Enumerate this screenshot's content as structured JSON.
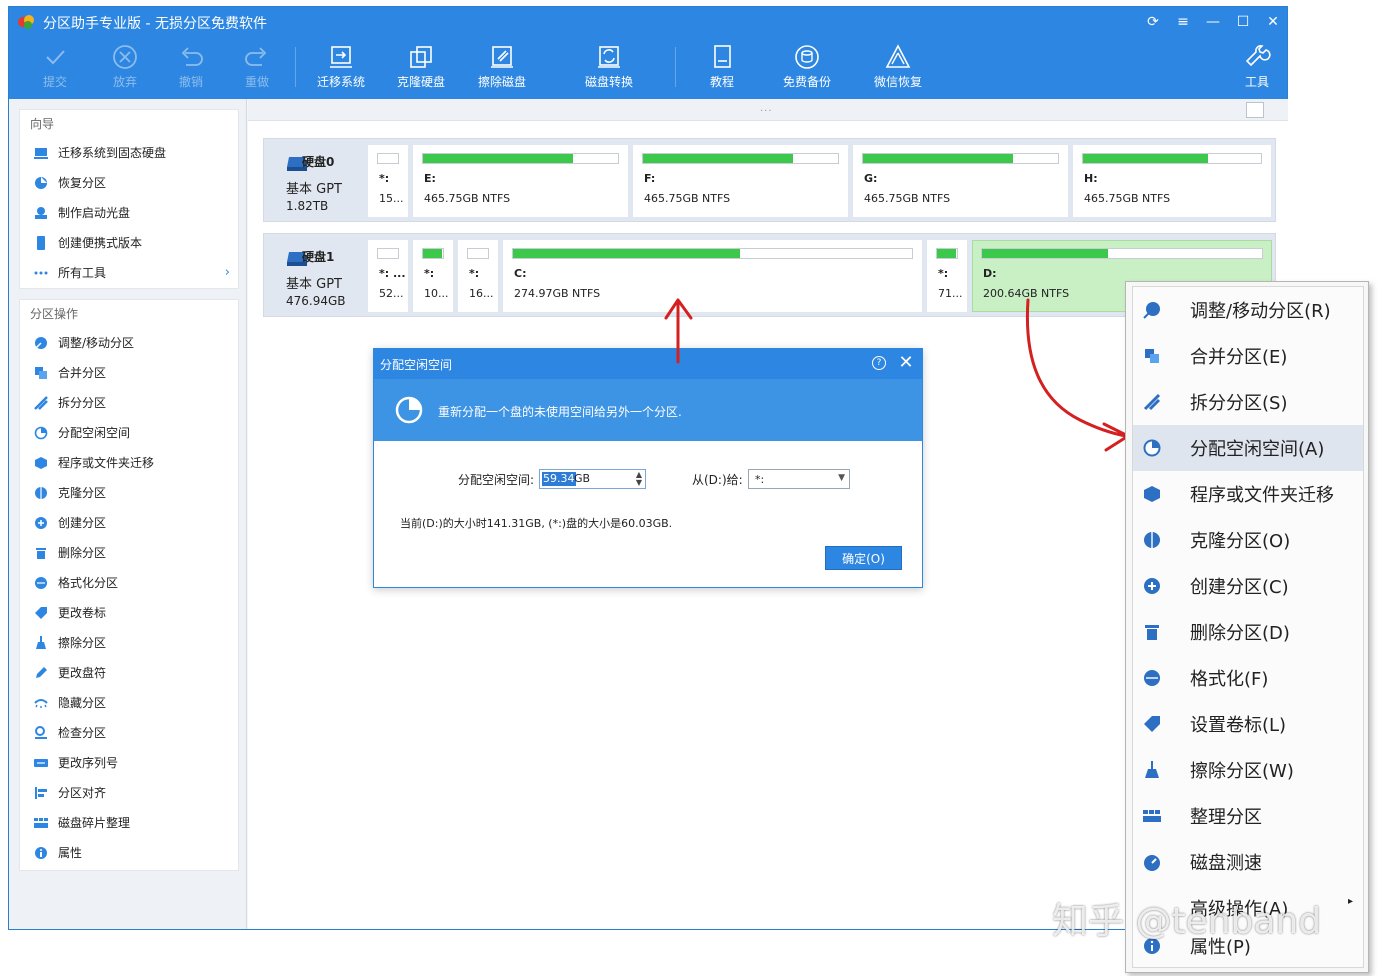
{
  "window": {
    "title": "分区助手专业版 - 无损分区免费软件",
    "controls": {
      "refresh": "⟳",
      "menu": "≡",
      "min": "—",
      "max": "☐",
      "close": "✕"
    }
  },
  "toolbar": {
    "commit": "提交",
    "discard": "放弃",
    "undo": "撤销",
    "redo": "重做",
    "migrate_os": "迁移系统",
    "clone_disk": "克隆硬盘",
    "wipe_disk": "擦除磁盘",
    "disk_convert": "磁盘转换",
    "tutorial": "教程",
    "free_backup": "免费备份",
    "wechat_recover": "微信恢复",
    "tools": "工具"
  },
  "sidebar": {
    "wizard_header": "向导",
    "wizard": [
      "迁移系统到固态硬盘",
      "恢复分区",
      "制作启动光盘",
      "创建便携式版本",
      "所有工具"
    ],
    "ops_header": "分区操作",
    "ops": [
      "调整/移动分区",
      "合并分区",
      "拆分分区",
      "分配空闲空间",
      "程序或文件夹迁移",
      "克隆分区",
      "创建分区",
      "删除分区",
      "格式化分区",
      "更改卷标",
      "擦除分区",
      "更改盘符",
      "隐藏分区",
      "检查分区",
      "更改序列号",
      "分区对齐",
      "磁盘碎片整理",
      "属性"
    ]
  },
  "main": {
    "drag_handle": "···"
  },
  "disks": [
    {
      "name": "硬盘0",
      "type": "基本 GPT",
      "size": "1.82TB",
      "partitions": [
        {
          "label": "*:",
          "info": "15...",
          "fill": 0
        },
        {
          "label": "E:",
          "info": "465.75GB NTFS",
          "fill": 0.77
        },
        {
          "label": "F:",
          "info": "465.75GB NTFS",
          "fill": 0.77
        },
        {
          "label": "G:",
          "info": "465.75GB NTFS",
          "fill": 0.77
        },
        {
          "label": "H:",
          "info": "465.75GB NTFS",
          "fill": 0.7
        }
      ]
    },
    {
      "name": "硬盘1",
      "type": "基本 GPT",
      "size": "476.94GB",
      "partitions": [
        {
          "label": "*: ...",
          "info": "52...",
          "fill": 0
        },
        {
          "label": "*:",
          "info": "10...",
          "fill": 0.95
        },
        {
          "label": "*:",
          "info": "16...",
          "fill": 0
        },
        {
          "label": "C:",
          "info": "274.97GB NTFS",
          "fill": 0.57
        },
        {
          "label": "*:",
          "info": "71...",
          "fill": 0.95
        },
        {
          "label": "D:",
          "info": "200.64GB NTFS",
          "fill": 0.45
        }
      ]
    }
  ],
  "dialog": {
    "title": "分配空闲空间",
    "help": "?",
    "close": "✕",
    "banner": "重新分配一个盘的未使用空间给另外一个分区.",
    "amount_label": "分配空闲空间:",
    "amount_value": "59.34",
    "amount_unit": "GB",
    "spin": "▲▼",
    "from_label": "从(D:)给:",
    "from_value": "*:",
    "from_arrow": "▼",
    "note": "当前(D:)的大小时141.31GB, (*:)盘的大小是60.03GB.",
    "ok": "确定(O)"
  },
  "context_menu": [
    {
      "label": "调整/移动分区(R)",
      "icon": "resize-icon"
    },
    {
      "label": "合并分区(E)",
      "icon": "merge-icon"
    },
    {
      "label": "拆分分区(S)",
      "icon": "split-icon"
    },
    {
      "label": "分配空闲空间(A)",
      "icon": "allocate-icon"
    },
    {
      "label": "程序或文件夹迁移",
      "icon": "app-move-icon"
    },
    {
      "label": "克隆分区(O)",
      "icon": "clone-icon"
    },
    {
      "label": "创建分区(C)",
      "icon": "create-icon"
    },
    {
      "label": "删除分区(D)",
      "icon": "trash-icon"
    },
    {
      "label": "格式化(F)",
      "icon": "format-icon"
    },
    {
      "label": "设置卷标(L)",
      "icon": "tag-icon"
    },
    {
      "label": "擦除分区(W)",
      "icon": "wipe-icon"
    },
    {
      "label": "整理分区",
      "icon": "defrag-icon"
    },
    {
      "label": "磁盘测速",
      "icon": "speed-icon"
    },
    {
      "label": "高级操作(A)",
      "icon": "",
      "submenu_arrow": "▸"
    },
    {
      "label": "属性(P)",
      "icon": "info-icon"
    }
  ],
  "watermark": "知乎 @tenband",
  "colors": {
    "brand": "#2d86e1",
    "bar": "#3cc84b",
    "selected_partition": "#c9f0c4",
    "annotation": "#d42020"
  }
}
